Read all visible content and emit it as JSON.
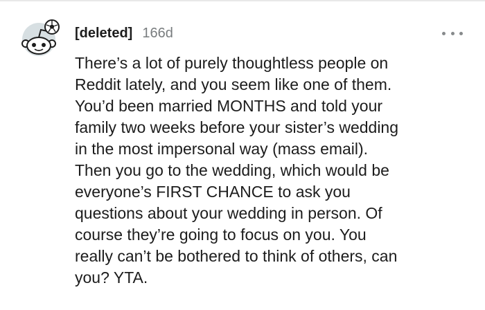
{
  "comment": {
    "username": "[deleted]",
    "age": "166d",
    "more_icon": "more-horizontal-icon",
    "avatar_icon": "snoo-avatar-icon",
    "body_lines": [
      "There’s a lot of purely thoughtless people on",
      "Reddit lately, and you seem like one of them.",
      "You’d been married MONTHS and told your",
      "family two weeks before your sister’s wedding",
      "in the most impersonal way (mass email).",
      "Then you go to the wedding, which would be",
      "everyone’s FIRST CHANCE to ask you",
      "questions about your wedding in person. Of",
      "course they’re going to focus on you. You",
      "really can’t be bothered to think of others, can",
      "you? YTA."
    ]
  },
  "colors": {
    "avatar_bg": "#d7dfe2",
    "snoo_body": "#ffffff",
    "outline": "#1c1c1c",
    "meta_gray": "#787c7e"
  }
}
